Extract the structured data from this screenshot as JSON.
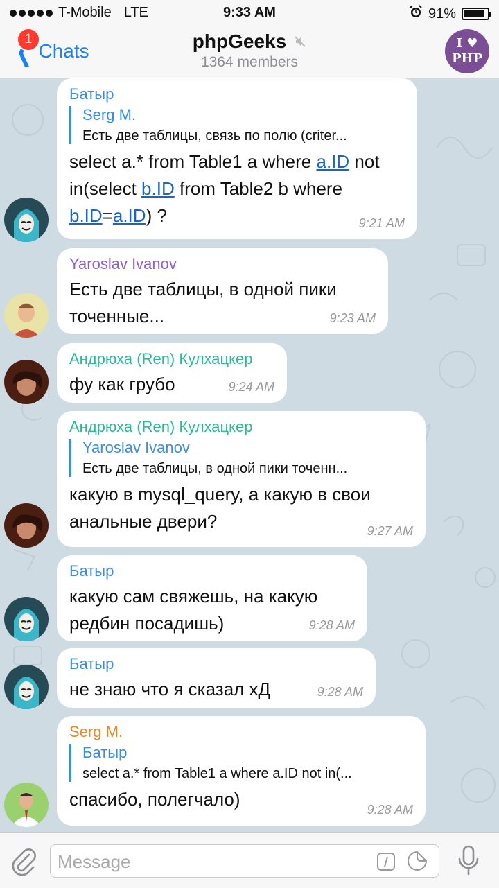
{
  "status_bar": {
    "carrier": "T-Mobile",
    "network": "LTE",
    "time": "9:33 AM",
    "battery": "91%",
    "battery_level": 0.91
  },
  "header": {
    "back_label": "Chats",
    "unread_badge": "1",
    "title": "phpGeeks",
    "subtitle": "1364 members",
    "avatar_text_line1": "I ♥",
    "avatar_text_line2": "PHP"
  },
  "colors": {
    "accent": "#1a82f7",
    "badge": "#ff3b30",
    "batyr": "#3e8ad9",
    "yaroslav": "#8e5fd0",
    "andryuha": "#2cb89a",
    "serg": "#e08a2c"
  },
  "messages": [
    {
      "sender": "Батыр",
      "reply_name": "Serg M.",
      "reply_text": "Есть две таблицы, связь по полю (criter...",
      "text_parts": [
        "select a.* from Table1 a where ",
        "a.ID",
        " not in(select ",
        "b.ID",
        " from Table2 b where ",
        "b.ID",
        "=",
        "a.ID",
        ") ?"
      ],
      "time": "9:21 AM"
    },
    {
      "sender": "Yaroslav Ivanov",
      "text": "Есть две таблицы, в одной пики точенные...",
      "time": "9:23 AM"
    },
    {
      "sender": "Андрюха (Ren) Кулхацкер",
      "text": "фу как грубо",
      "time": "9:24 AM"
    },
    {
      "sender": "Андрюха (Ren) Кулхацкер",
      "reply_name": "Yaroslav Ivanov",
      "reply_text": "Есть две таблицы, в одной пики точенн...",
      "text": "какую в mysql_query, а какую в свои анальные двери?",
      "time": "9:27 AM"
    },
    {
      "sender": "Батыр",
      "text": "какую сам свяжешь, на какую редбин посадишь)",
      "time": "9:28 AM"
    },
    {
      "sender": "Батыр",
      "text": "не знаю что я сказал хД",
      "time": "9:28 AM"
    },
    {
      "sender": "Serg M.",
      "reply_name": "Батыр",
      "reply_text": "select a.* from Table1 a where a.ID not in(...",
      "text": "спасибо, полегчало)",
      "time": "9:28 AM"
    }
  ],
  "input": {
    "placeholder": "Message"
  }
}
